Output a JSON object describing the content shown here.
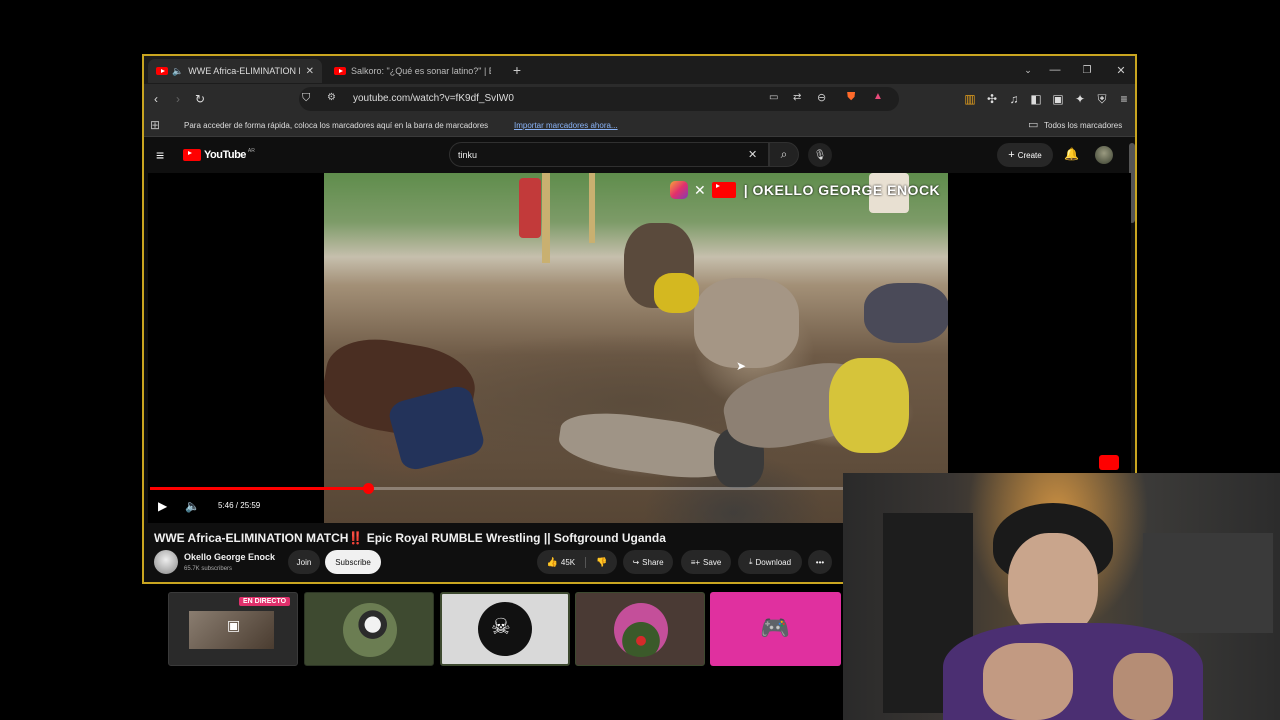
{
  "browser": {
    "tabs": [
      {
        "title": "WWE Africa-ELIMINATION M...",
        "active": true
      },
      {
        "title": "Salkoro: \"¿Qué es sonar latino?\" | Ent",
        "active": false
      }
    ],
    "url": "youtube.com/watch?v=fK9df_SvIW0",
    "bookmarks_hint": "Para acceder de forma rápida, coloca los marcadores aquí en la barra de marcadores",
    "import_link": "Importar marcadores ahora...",
    "all_bookmarks": "Todos los marcadores"
  },
  "youtube": {
    "logo_text": "YouTube",
    "logo_region": "AR",
    "search_value": "tinku",
    "create_label": "Create",
    "video": {
      "watermark": "| OKELLO GEORGE ENOCK",
      "time": "5:46 / 25:59",
      "progress_fraction": 0.222,
      "title": "WWE Africa-ELIMINATION MATCH‼️ Epic Royal RUMBLE Wrestling || Softground Uganda"
    },
    "channel": {
      "name": "Okello George Enock",
      "subscribers": "65.7K subscribers",
      "join": "Join",
      "subscribe": "Subscribe"
    },
    "actions": {
      "likes": "45K",
      "share": "Share",
      "save": "Save",
      "download": "Download"
    }
  },
  "overlay": {
    "live_badge": "EN DIRECTO"
  },
  "colors": {
    "frame": "#c9a520",
    "youtube_red": "#ff0000",
    "discord": "#e0309f"
  }
}
